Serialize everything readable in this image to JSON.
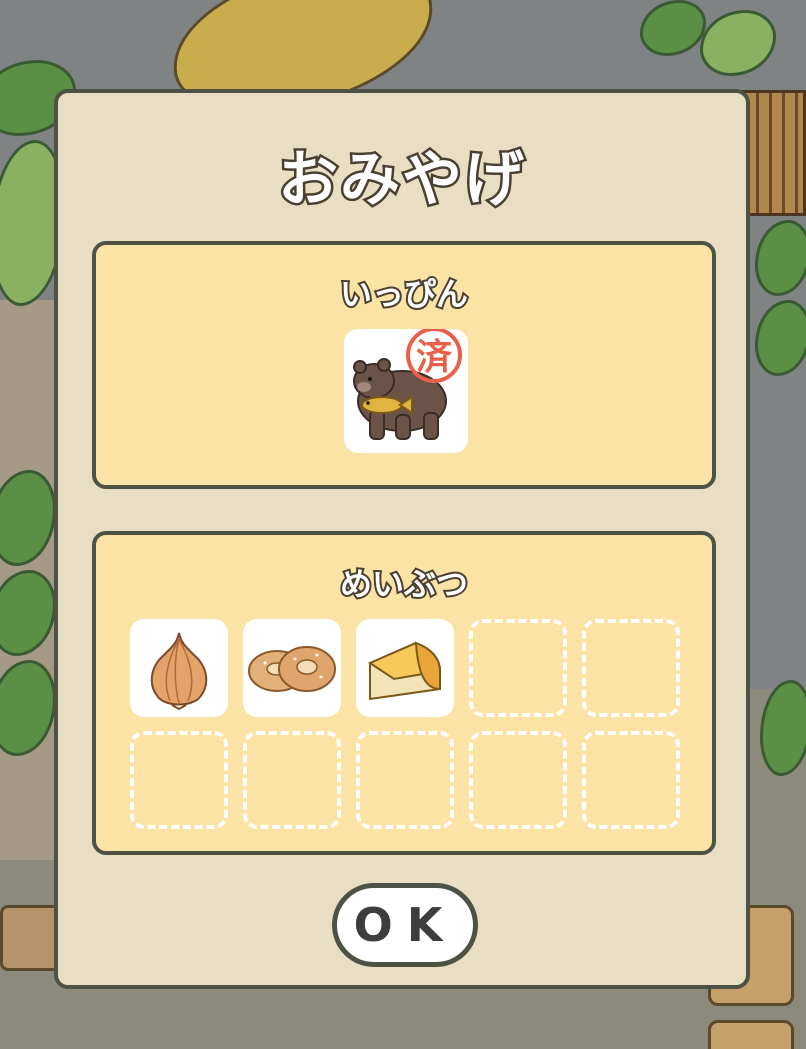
{
  "dialog": {
    "title": "おみやげ",
    "special": {
      "label": "いっぴん",
      "item": {
        "icon": "bear-with-fish-icon",
        "stamp": "済"
      }
    },
    "local": {
      "label": "めいぶつ",
      "items": [
        {
          "icon": "onion-icon",
          "filled": true
        },
        {
          "icon": "bagel-icon",
          "filled": true
        },
        {
          "icon": "cheese-icon",
          "filled": true
        },
        {
          "filled": false
        },
        {
          "filled": false
        },
        {
          "filled": false
        },
        {
          "filled": false
        },
        {
          "filled": false
        },
        {
          "filled": false
        },
        {
          "filled": false
        }
      ]
    },
    "ok_label": "OK"
  },
  "colors": {
    "dialog_bg": "#e7dec3",
    "panel_bg": "#fbe3a6",
    "border": "#4e5245",
    "stamp": "#e8604a"
  }
}
